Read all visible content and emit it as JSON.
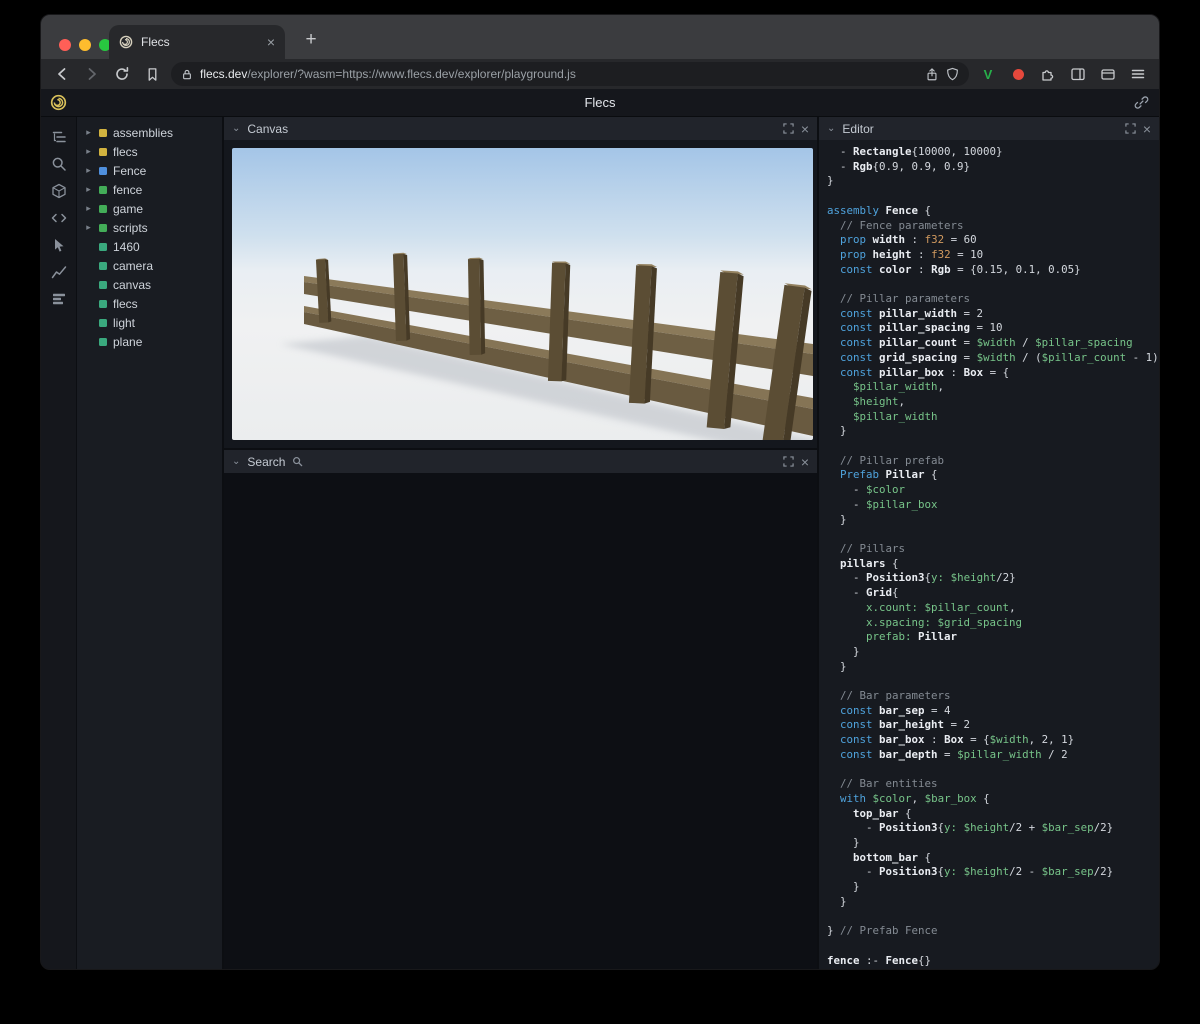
{
  "icons": {
    "chevron_down": "⌄",
    "tree_arrow": "▸",
    "close": "×",
    "plus": "+"
  },
  "browser": {
    "tab_title": "Flecs",
    "url_domain": "flecs.dev",
    "url_path": "/explorer/?wasm=https://www.flecs.dev/explorer/playground.js",
    "v_label": "V"
  },
  "app": {
    "title": "Flecs"
  },
  "panels": {
    "canvas": {
      "title": "Canvas"
    },
    "search": {
      "title": "Search"
    },
    "editor": {
      "title": "Editor"
    }
  },
  "tree": {
    "palette": {
      "yellow": "#d2b33f",
      "blue": "#4f8fdd",
      "green": "#43ad58",
      "teal": "#3aa97e"
    },
    "items": [
      {
        "label": "assemblies",
        "color": "yellow",
        "expandable": true
      },
      {
        "label": "flecs",
        "color": "yellow",
        "expandable": true
      },
      {
        "label": "Fence",
        "color": "blue",
        "expandable": true
      },
      {
        "label": "fence",
        "color": "green",
        "expandable": true
      },
      {
        "label": "game",
        "color": "green",
        "expandable": true
      },
      {
        "label": "scripts",
        "color": "green",
        "expandable": true
      },
      {
        "label": "1460",
        "color": "teal",
        "expandable": false
      },
      {
        "label": "camera",
        "color": "teal",
        "expandable": false
      },
      {
        "label": "canvas",
        "color": "teal",
        "expandable": false
      },
      {
        "label": "flecs",
        "color": "teal",
        "expandable": false
      },
      {
        "label": "light",
        "color": "teal",
        "expandable": false
      },
      {
        "label": "plane",
        "color": "teal",
        "expandable": false
      }
    ]
  },
  "editor": {
    "lines": [
      [
        [
          "df",
          "  - "
        ],
        [
          "bd",
          "Rectangle"
        ],
        [
          "df",
          "{10000, 10000}"
        ]
      ],
      [
        [
          "df",
          "  - "
        ],
        [
          "bd",
          "Rgb"
        ],
        [
          "df",
          "{0.9, 0.9, 0.9}"
        ]
      ],
      [
        [
          "df",
          "}"
        ]
      ],
      [],
      [
        [
          "kw",
          "assembly"
        ],
        [
          "df",
          " "
        ],
        [
          "bd",
          "Fence"
        ],
        [
          "df",
          " {"
        ]
      ],
      [
        [
          "cm",
          "  // Fence parameters"
        ]
      ],
      [
        [
          "df",
          "  "
        ],
        [
          "kw",
          "prop"
        ],
        [
          "bd",
          " width"
        ],
        [
          "df",
          " : "
        ],
        [
          "ty",
          "f32"
        ],
        [
          "df",
          " = 60"
        ]
      ],
      [
        [
          "df",
          "  "
        ],
        [
          "kw",
          "prop"
        ],
        [
          "bd",
          " height"
        ],
        [
          "df",
          " : "
        ],
        [
          "ty",
          "f32"
        ],
        [
          "df",
          " = 10"
        ]
      ],
      [
        [
          "df",
          "  "
        ],
        [
          "kw",
          "const"
        ],
        [
          "bd",
          " color"
        ],
        [
          "df",
          " : "
        ],
        [
          "bd",
          "Rgb"
        ],
        [
          "df",
          " = {0.15, 0.1, 0.05}"
        ]
      ],
      [],
      [
        [
          "cm",
          "  // Pillar parameters"
        ]
      ],
      [
        [
          "df",
          "  "
        ],
        [
          "kw",
          "const"
        ],
        [
          "bd",
          " pillar_width"
        ],
        [
          "df",
          " = 2"
        ]
      ],
      [
        [
          "df",
          "  "
        ],
        [
          "kw",
          "const"
        ],
        [
          "bd",
          " pillar_spacing"
        ],
        [
          "df",
          " = 10"
        ]
      ],
      [
        [
          "df",
          "  "
        ],
        [
          "kw",
          "const"
        ],
        [
          "bd",
          " pillar_count"
        ],
        [
          "df",
          " = "
        ],
        [
          "var",
          "$width"
        ],
        [
          "df",
          " / "
        ],
        [
          "var",
          "$pillar_spacing"
        ]
      ],
      [
        [
          "df",
          "  "
        ],
        [
          "kw",
          "const"
        ],
        [
          "bd",
          " grid_spacing"
        ],
        [
          "df",
          " = "
        ],
        [
          "var",
          "$width"
        ],
        [
          "df",
          " / ("
        ],
        [
          "var",
          "$pillar_count"
        ],
        [
          "df",
          " - 1)"
        ]
      ],
      [
        [
          "df",
          "  "
        ],
        [
          "kw",
          "const"
        ],
        [
          "bd",
          " pillar_box"
        ],
        [
          "df",
          " : "
        ],
        [
          "bd",
          "Box"
        ],
        [
          "df",
          " = {"
        ]
      ],
      [
        [
          "df",
          "    "
        ],
        [
          "var",
          "$pillar_width"
        ],
        [
          "df",
          ","
        ]
      ],
      [
        [
          "df",
          "    "
        ],
        [
          "var",
          "$height"
        ],
        [
          "df",
          ","
        ]
      ],
      [
        [
          "df",
          "    "
        ],
        [
          "var",
          "$pillar_width"
        ]
      ],
      [
        [
          "df",
          "  }"
        ]
      ],
      [],
      [
        [
          "cm",
          "  // Pillar prefab"
        ]
      ],
      [
        [
          "df",
          "  "
        ],
        [
          "kw",
          "Prefab"
        ],
        [
          "bd",
          " Pillar"
        ],
        [
          "df",
          " {"
        ]
      ],
      [
        [
          "df",
          "    - "
        ],
        [
          "var",
          "$color"
        ]
      ],
      [
        [
          "df",
          "    - "
        ],
        [
          "var",
          "$pillar_box"
        ]
      ],
      [
        [
          "df",
          "  }"
        ]
      ],
      [],
      [
        [
          "cm",
          "  // Pillars"
        ]
      ],
      [
        [
          "df",
          "  "
        ],
        [
          "bd",
          "pillars"
        ],
        [
          "df",
          " {"
        ]
      ],
      [
        [
          "df",
          "    - "
        ],
        [
          "bd",
          "Position3"
        ],
        [
          "df",
          "{"
        ],
        [
          "var",
          "y:"
        ],
        [
          "df",
          " "
        ],
        [
          "var",
          "$height"
        ],
        [
          "df",
          "/2}"
        ]
      ],
      [
        [
          "df",
          "    - "
        ],
        [
          "bd",
          "Grid"
        ],
        [
          "df",
          "{"
        ]
      ],
      [
        [
          "df",
          "      "
        ],
        [
          "var",
          "x.count:"
        ],
        [
          "df",
          " "
        ],
        [
          "var",
          "$pillar_count"
        ],
        [
          "df",
          ","
        ]
      ],
      [
        [
          "df",
          "      "
        ],
        [
          "var",
          "x.spacing:"
        ],
        [
          "df",
          " "
        ],
        [
          "var",
          "$grid_spacing"
        ]
      ],
      [
        [
          "df",
          "      "
        ],
        [
          "var",
          "prefab:"
        ],
        [
          "df",
          " "
        ],
        [
          "bd",
          "Pillar"
        ]
      ],
      [
        [
          "df",
          "    }"
        ]
      ],
      [
        [
          "df",
          "  }"
        ]
      ],
      [],
      [
        [
          "cm",
          "  // Bar parameters"
        ]
      ],
      [
        [
          "df",
          "  "
        ],
        [
          "kw",
          "const"
        ],
        [
          "bd",
          " bar_sep"
        ],
        [
          "df",
          " = 4"
        ]
      ],
      [
        [
          "df",
          "  "
        ],
        [
          "kw",
          "const"
        ],
        [
          "bd",
          " bar_height"
        ],
        [
          "df",
          " = 2"
        ]
      ],
      [
        [
          "df",
          "  "
        ],
        [
          "kw",
          "const"
        ],
        [
          "bd",
          " bar_box"
        ],
        [
          "df",
          " : "
        ],
        [
          "bd",
          "Box"
        ],
        [
          "df",
          " = {"
        ],
        [
          "var",
          "$width"
        ],
        [
          "df",
          ", 2, 1}"
        ]
      ],
      [
        [
          "df",
          "  "
        ],
        [
          "kw",
          "const"
        ],
        [
          "bd",
          " bar_depth"
        ],
        [
          "df",
          " = "
        ],
        [
          "var",
          "$pillar_width"
        ],
        [
          "df",
          " / 2"
        ]
      ],
      [],
      [
        [
          "cm",
          "  // Bar entities"
        ]
      ],
      [
        [
          "df",
          "  "
        ],
        [
          "kw",
          "with"
        ],
        [
          "df",
          " "
        ],
        [
          "var",
          "$color"
        ],
        [
          "df",
          ", "
        ],
        [
          "var",
          "$bar_box"
        ],
        [
          "df",
          " {"
        ]
      ],
      [
        [
          "df",
          "    "
        ],
        [
          "bd",
          "top_bar"
        ],
        [
          "df",
          " {"
        ]
      ],
      [
        [
          "df",
          "      - "
        ],
        [
          "bd",
          "Position3"
        ],
        [
          "df",
          "{"
        ],
        [
          "var",
          "y:"
        ],
        [
          "df",
          " "
        ],
        [
          "var",
          "$height"
        ],
        [
          "df",
          "/2 + "
        ],
        [
          "var",
          "$bar_sep"
        ],
        [
          "df",
          "/2}"
        ]
      ],
      [
        [
          "df",
          "    }"
        ]
      ],
      [
        [
          "df",
          "    "
        ],
        [
          "bd",
          "bottom_bar"
        ],
        [
          "df",
          " {"
        ]
      ],
      [
        [
          "df",
          "      - "
        ],
        [
          "bd",
          "Position3"
        ],
        [
          "df",
          "{"
        ],
        [
          "var",
          "y:"
        ],
        [
          "df",
          " "
        ],
        [
          "var",
          "$height"
        ],
        [
          "df",
          "/2 - "
        ],
        [
          "var",
          "$bar_sep"
        ],
        [
          "df",
          "/2}"
        ]
      ],
      [
        [
          "df",
          "    }"
        ]
      ],
      [
        [
          "df",
          "  }"
        ]
      ],
      [],
      [
        [
          "df",
          "} "
        ],
        [
          "cm",
          "// Prefab Fence"
        ]
      ],
      [],
      [
        [
          "bd",
          "fence"
        ],
        [
          "df",
          " :- "
        ],
        [
          "bd",
          "Fence"
        ],
        [
          "df",
          "{}"
        ]
      ]
    ]
  }
}
